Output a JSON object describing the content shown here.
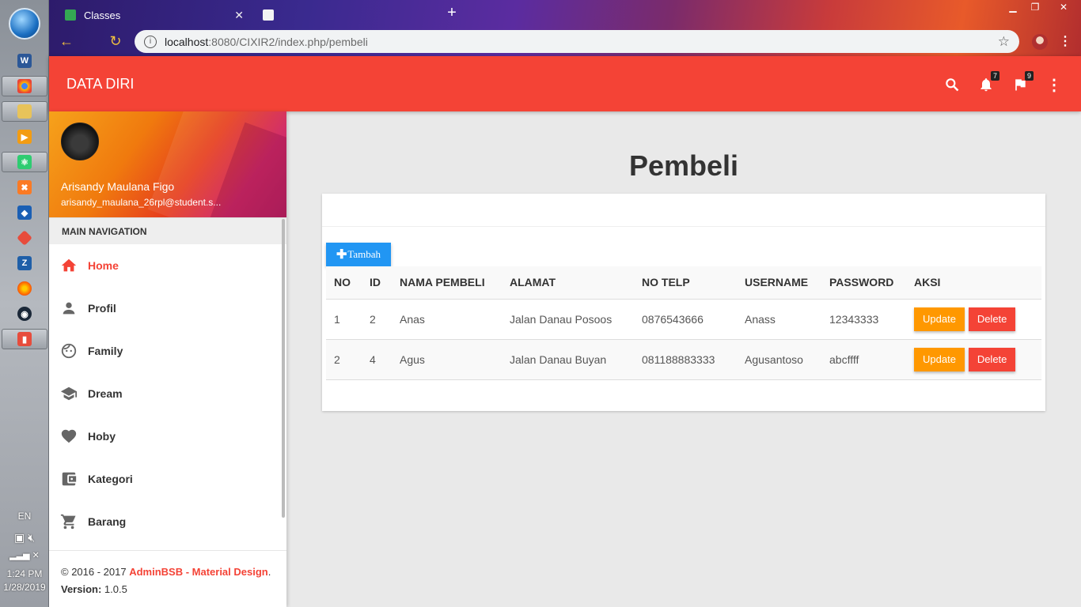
{
  "taskbar": {
    "lang": "EN",
    "time": "1:24 PM",
    "date": "1/28/2019",
    "apps": [
      "word-icon",
      "chrome-icon",
      "explorer-icon",
      "media-player-icon",
      "atom-icon",
      "xampp-icon",
      "virtualbox-icon",
      "git-icon",
      "filezilla-icon",
      "firefox-icon",
      "steam-icon",
      "office-icon"
    ]
  },
  "browser": {
    "tab_title": "Classes",
    "url_host": "localhost",
    "url_path": ":8080/CIXIR2/index.php/pembeli"
  },
  "appbar": {
    "brand": "DATA DIRI",
    "notifications_count": "7",
    "tasks_count": "9"
  },
  "user": {
    "name": "Arisandy Maulana Figo",
    "email": "arisandy_maulana_26rpl@student.s..."
  },
  "sidebar": {
    "header": "MAIN NAVIGATION",
    "items": [
      {
        "label": "Home",
        "icon": "home-icon"
      },
      {
        "label": "Profil",
        "icon": "person-icon"
      },
      {
        "label": "Family",
        "icon": "face-icon"
      },
      {
        "label": "Dream",
        "icon": "school-icon"
      },
      {
        "label": "Hoby",
        "icon": "heart-icon"
      },
      {
        "label": "Kategori",
        "icon": "wallet-icon"
      },
      {
        "label": "Barang",
        "icon": "cart-icon"
      }
    ]
  },
  "legal": {
    "copyright_prefix": "© 2016 - 2017 ",
    "copyright_link": "AdminBSB - Material Design",
    "copyright_suffix": ".",
    "version_label": "Version:",
    "version_value": " 1.0.5"
  },
  "page": {
    "title": "Pembeli",
    "add_button": "Tambah"
  },
  "table": {
    "columns": [
      "NO",
      "ID",
      "NAMA PEMBELI",
      "ALAMAT",
      "NO TELP",
      "USERNAME",
      "PASSWORD",
      "AKSI"
    ],
    "rows": [
      [
        "1",
        "2",
        "Anas",
        "Jalan Danau Posoos",
        "0876543666",
        "Anass",
        "12343333"
      ],
      [
        "2",
        "4",
        "Agus",
        "Jalan Danau Buyan",
        "081188883333",
        "Agusantoso",
        "abcffff"
      ]
    ],
    "update_label": "Update",
    "delete_label": "Delete"
  }
}
